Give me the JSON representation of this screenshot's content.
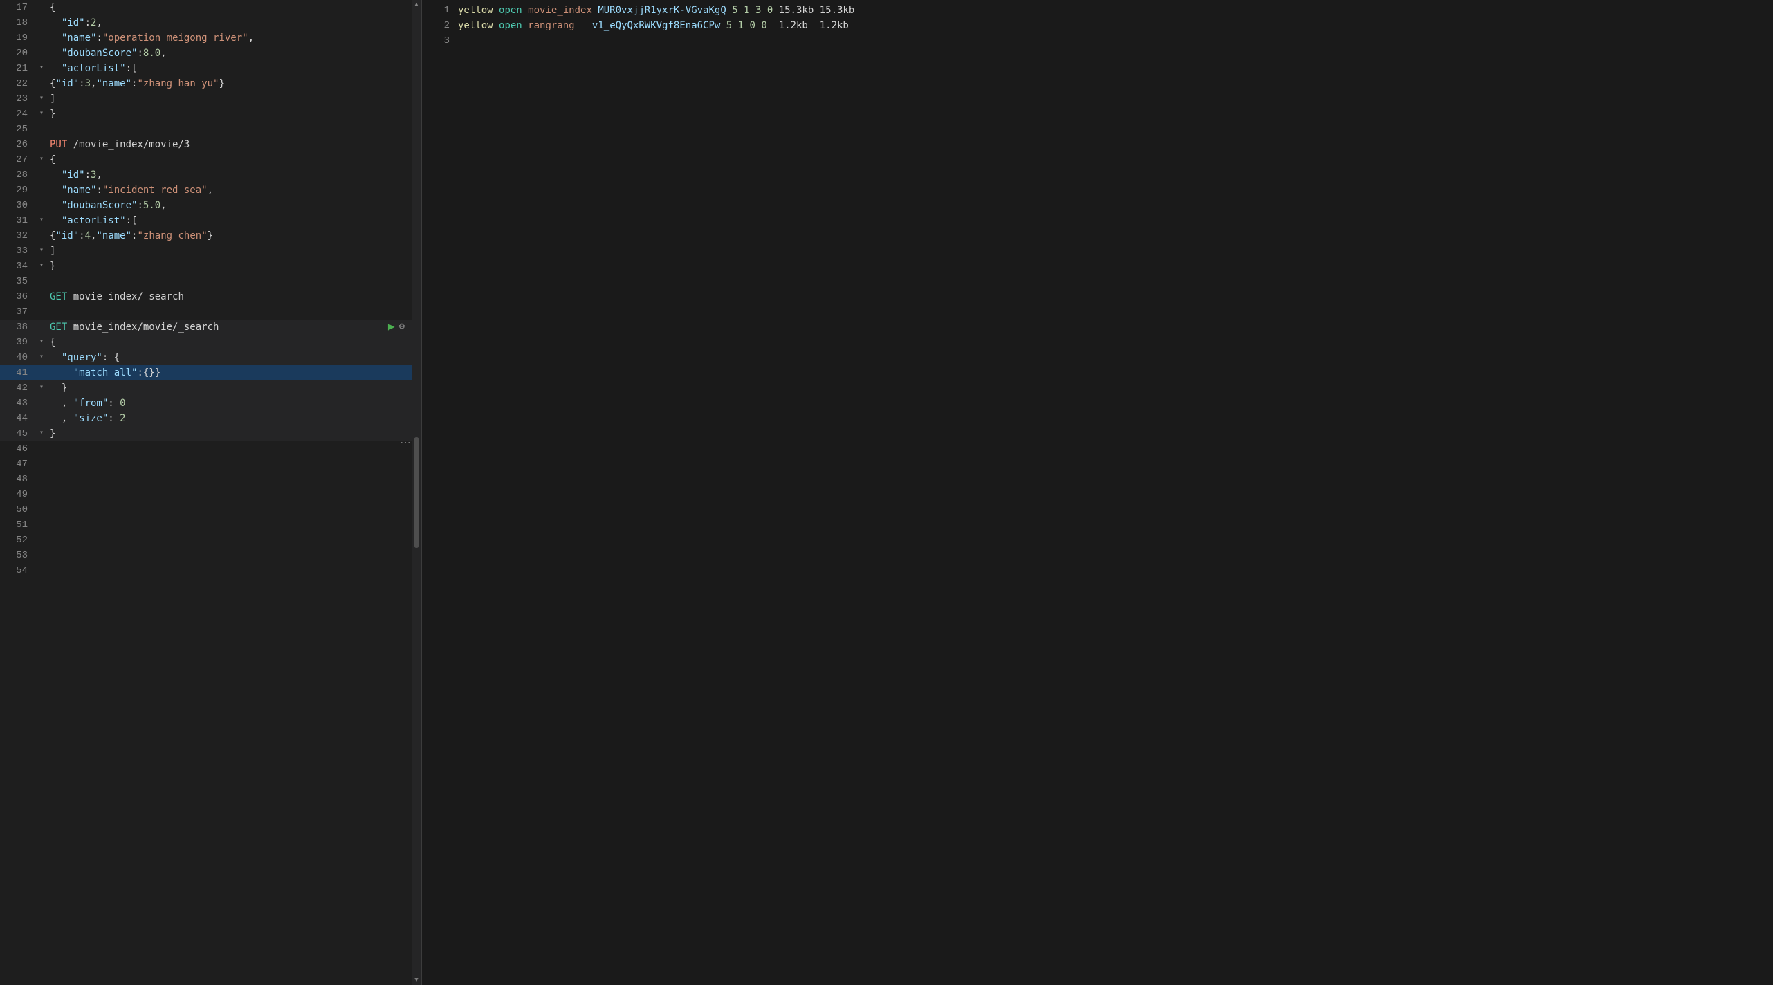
{
  "leftPanel": {
    "lines": [
      {
        "number": 17,
        "content": "{",
        "tokens": [
          {
            "text": "{",
            "class": "c-white"
          }
        ],
        "indent": 0
      },
      {
        "number": 18,
        "content": "  \"id\":2,",
        "tokens": [
          {
            "text": "  ",
            "class": ""
          },
          {
            "text": "\"id\"",
            "class": "key-color"
          },
          {
            "text": ":",
            "class": "c-white"
          },
          {
            "text": "2",
            "class": "number-color"
          },
          {
            "text": ",",
            "class": "c-white"
          }
        ],
        "indent": 0
      },
      {
        "number": 19,
        "content": "  \"name\":\"operation meigong river\",",
        "tokens": [
          {
            "text": "  ",
            "class": ""
          },
          {
            "text": "\"name\"",
            "class": "key-color"
          },
          {
            "text": ":",
            "class": "c-white"
          },
          {
            "text": "\"operation meigong river\"",
            "class": "string-color"
          },
          {
            "text": ",",
            "class": "c-white"
          }
        ],
        "indent": 0
      },
      {
        "number": 20,
        "content": "  \"doubanScore\":8.0,",
        "tokens": [
          {
            "text": "  ",
            "class": ""
          },
          {
            "text": "\"doubanScore\"",
            "class": "key-color"
          },
          {
            "text": ":",
            "class": "c-white"
          },
          {
            "text": "8.0",
            "class": "number-color"
          },
          {
            "text": ",",
            "class": "c-white"
          }
        ],
        "indent": 0
      },
      {
        "number": 21,
        "content": "  \"actorList\":[",
        "tokens": [
          {
            "text": "  ",
            "class": ""
          },
          {
            "text": "\"actorList\"",
            "class": "key-color"
          },
          {
            "text": ":[",
            "class": "c-white"
          }
        ],
        "indent": 0,
        "hasArrow": true
      },
      {
        "number": 22,
        "content": "{\"id\":3,\"name\":\"zhang han yu\"}",
        "tokens": [
          {
            "text": "{",
            "class": "c-white"
          },
          {
            "text": "\"id\"",
            "class": "key-color"
          },
          {
            "text": ":",
            "class": "c-white"
          },
          {
            "text": "3",
            "class": "number-color"
          },
          {
            "text": ",",
            "class": "c-white"
          },
          {
            "text": "\"name\"",
            "class": "key-color"
          },
          {
            "text": ":",
            "class": "c-white"
          },
          {
            "text": "\"zhang han yu\"",
            "class": "string-color"
          },
          {
            "text": "}",
            "class": "c-white"
          }
        ],
        "indent": 0
      },
      {
        "number": 23,
        "content": "]",
        "tokens": [
          {
            "text": "]",
            "class": "c-white"
          }
        ],
        "indent": 0,
        "hasArrow": true
      },
      {
        "number": 24,
        "content": "}",
        "tokens": [
          {
            "text": "}",
            "class": "c-white"
          }
        ],
        "indent": 0,
        "hasArrow": true
      },
      {
        "number": 25,
        "content": "",
        "tokens": [],
        "indent": 0
      },
      {
        "number": 26,
        "content": "PUT /movie_index/movie/3",
        "tokens": [
          {
            "text": "PUT",
            "class": "put-method"
          },
          {
            "text": " /movie_index/movie/3",
            "class": "c-white"
          }
        ],
        "indent": 0
      },
      {
        "number": 27,
        "content": "{",
        "tokens": [
          {
            "text": "{",
            "class": "c-white"
          }
        ],
        "indent": 0,
        "hasArrow": true
      },
      {
        "number": 28,
        "content": "  \"id\":3,",
        "tokens": [
          {
            "text": "  ",
            "class": ""
          },
          {
            "text": "\"id\"",
            "class": "key-color"
          },
          {
            "text": ":",
            "class": "c-white"
          },
          {
            "text": "3",
            "class": "number-color"
          },
          {
            "text": ",",
            "class": "c-white"
          }
        ],
        "indent": 0
      },
      {
        "number": 29,
        "content": "  \"name\":\"incident red sea\",",
        "tokens": [
          {
            "text": "  ",
            "class": ""
          },
          {
            "text": "\"name\"",
            "class": "key-color"
          },
          {
            "text": ":",
            "class": "c-white"
          },
          {
            "text": "\"incident red sea\"",
            "class": "string-color"
          },
          {
            "text": ",",
            "class": "c-white"
          }
        ],
        "indent": 0
      },
      {
        "number": 30,
        "content": "  \"doubanScore\":5.0,",
        "tokens": [
          {
            "text": "  ",
            "class": ""
          },
          {
            "text": "\"doubanScore\"",
            "class": "key-color"
          },
          {
            "text": ":",
            "class": "c-white"
          },
          {
            "text": "5.0",
            "class": "number-color"
          },
          {
            "text": ",",
            "class": "c-white"
          }
        ],
        "indent": 0
      },
      {
        "number": 31,
        "content": "  \"actorList\":[",
        "tokens": [
          {
            "text": "  ",
            "class": ""
          },
          {
            "text": "\"actorList\"",
            "class": "key-color"
          },
          {
            "text": ":[",
            "class": "c-white"
          }
        ],
        "indent": 0,
        "hasArrow": true
      },
      {
        "number": 32,
        "content": "{\"id\":4,\"name\":\"zhang chen\"}",
        "tokens": [
          {
            "text": "{",
            "class": "c-white"
          },
          {
            "text": "\"id\"",
            "class": "key-color"
          },
          {
            "text": ":",
            "class": "c-white"
          },
          {
            "text": "4",
            "class": "number-color"
          },
          {
            "text": ",",
            "class": "c-white"
          },
          {
            "text": "\"name\"",
            "class": "key-color"
          },
          {
            "text": ":",
            "class": "c-white"
          },
          {
            "text": "\"zhang chen\"",
            "class": "string-color"
          },
          {
            "text": "}",
            "class": "c-white"
          }
        ],
        "indent": 0
      },
      {
        "number": 33,
        "content": "]",
        "tokens": [
          {
            "text": "]",
            "class": "c-white"
          }
        ],
        "indent": 0,
        "hasArrow": true
      },
      {
        "number": 34,
        "content": "}",
        "tokens": [
          {
            "text": "}",
            "class": "c-white"
          }
        ],
        "indent": 0,
        "hasArrow": true
      },
      {
        "number": 35,
        "content": "",
        "tokens": [],
        "indent": 0
      },
      {
        "number": 36,
        "content": "GET movie_index/_search",
        "tokens": [
          {
            "text": "GET",
            "class": "get-method"
          },
          {
            "text": " movie_index/_search",
            "class": "c-white"
          }
        ],
        "indent": 0
      },
      {
        "number": 37,
        "content": "",
        "tokens": [],
        "indent": 0
      },
      {
        "number": 38,
        "content": "GET movie_index/movie/_search",
        "tokens": [
          {
            "text": "GET",
            "class": "get-method"
          },
          {
            "text": " movie_index/movie/_search",
            "class": "c-white"
          }
        ],
        "indent": 0,
        "active": true,
        "hasActions": true
      },
      {
        "number": 39,
        "content": "{",
        "tokens": [
          {
            "text": "{",
            "class": "c-white"
          }
        ],
        "indent": 0,
        "hasArrow": true,
        "active": true
      },
      {
        "number": 40,
        "content": "  \"query\": {",
        "tokens": [
          {
            "text": "  ",
            "class": ""
          },
          {
            "text": "\"query\"",
            "class": "key-color"
          },
          {
            "text": ": {",
            "class": "c-white"
          }
        ],
        "indent": 0,
        "hasArrow": true,
        "active": true
      },
      {
        "number": 41,
        "content": "    \"match_all\":{}}",
        "tokens": [
          {
            "text": "    ",
            "class": ""
          },
          {
            "text": "\"match_all\"",
            "class": "key-color"
          },
          {
            "text": ":{}",
            "class": "c-white"
          },
          {
            "text": "}",
            "class": "c-white"
          }
        ],
        "indent": 0,
        "active": true,
        "currentLine": true
      },
      {
        "number": 42,
        "content": "  }",
        "tokens": [
          {
            "text": "  }",
            "class": "c-white"
          }
        ],
        "indent": 0,
        "hasArrow": true,
        "active": true
      },
      {
        "number": 43,
        "content": "  , \"from\": 0",
        "tokens": [
          {
            "text": "  , ",
            "class": "c-white"
          },
          {
            "text": "\"from\"",
            "class": "key-color"
          },
          {
            "text": ": ",
            "class": "c-white"
          },
          {
            "text": "0",
            "class": "number-color"
          }
        ],
        "indent": 0,
        "active": true
      },
      {
        "number": 44,
        "content": "  , \"size\": 2",
        "tokens": [
          {
            "text": "  , ",
            "class": "c-white"
          },
          {
            "text": "\"size\"",
            "class": "key-color"
          },
          {
            "text": ": ",
            "class": "c-white"
          },
          {
            "text": "2",
            "class": "number-color"
          }
        ],
        "indent": 0,
        "active": true
      },
      {
        "number": 45,
        "content": "}",
        "tokens": [
          {
            "text": "}",
            "class": "c-white"
          }
        ],
        "indent": 0,
        "hasArrow": true,
        "active": true
      },
      {
        "number": 46,
        "content": "",
        "tokens": [],
        "indent": 0
      },
      {
        "number": 47,
        "content": "",
        "tokens": [],
        "indent": 0
      },
      {
        "number": 48,
        "content": "",
        "tokens": [],
        "indent": 0
      },
      {
        "number": 49,
        "content": "",
        "tokens": [],
        "indent": 0
      },
      {
        "number": 50,
        "content": "",
        "tokens": [],
        "indent": 0
      },
      {
        "number": 51,
        "content": "",
        "tokens": [],
        "indent": 0
      },
      {
        "number": 52,
        "content": "",
        "tokens": [],
        "indent": 0
      },
      {
        "number": 53,
        "content": "",
        "tokens": [],
        "indent": 0
      },
      {
        "number": 54,
        "content": "",
        "tokens": [],
        "indent": 0
      }
    ]
  },
  "rightPanel": {
    "lines": [
      {
        "number": 1,
        "content": "yellow open movie_index MUR0vxjjR1yxrK-VGvaKgQ 5 1 3 0 15.3kb 15.3kb"
      },
      {
        "number": 2,
        "content": "yellow open rangrang   v1_eQyQxRWKVgf8Ena6CPw 5 1 0 0  1.2kb  1.2kb"
      },
      {
        "number": 3,
        "content": ""
      }
    ],
    "colors": {
      "yellow": "#dcdcaa",
      "open": "#4ec9b0",
      "indexName": "#ce9178",
      "id": "#9cdcfe",
      "numbers": "#b5cea8",
      "sizes": "#d4d4d4"
    }
  }
}
